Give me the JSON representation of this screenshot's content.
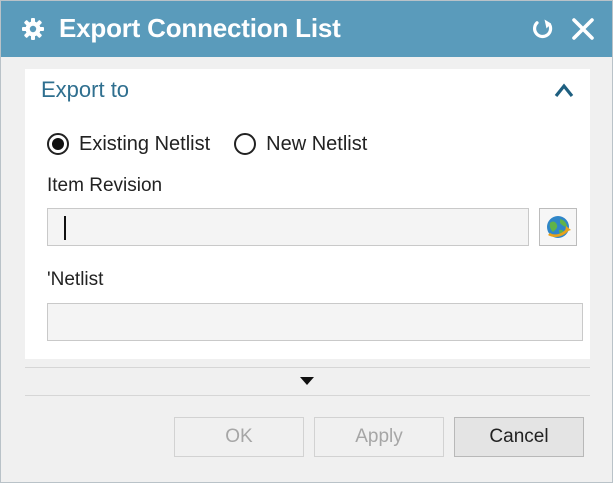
{
  "window": {
    "title": "Export Connection List",
    "title_icon": "gear-icon",
    "titlebar_color": "#5a9bbb"
  },
  "group": {
    "title": "Export to",
    "expanded": true,
    "accent_color": "#2f6f8f"
  },
  "radios": [
    {
      "label": "Existing Netlist",
      "checked": true
    },
    {
      "label": "New Netlist",
      "checked": false
    }
  ],
  "item_revision": {
    "label": "Item Revision",
    "value": "",
    "browse_icon": "globe-browse-icon"
  },
  "netlist": {
    "label": "'Netlist",
    "value": ""
  },
  "buttons": {
    "ok": {
      "label": "OK",
      "enabled": false
    },
    "apply": {
      "label": "Apply",
      "enabled": false
    },
    "cancel": {
      "label": "Cancel",
      "enabled": true
    }
  }
}
